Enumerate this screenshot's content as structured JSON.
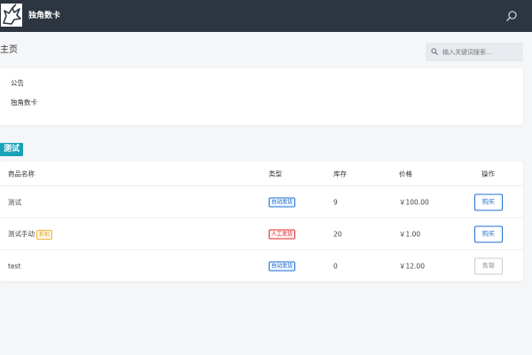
{
  "nav": {
    "brand": "独角数卡"
  },
  "header": {
    "page_title": "主页",
    "search_placeholder": "输入关键词搜索..."
  },
  "notice": {
    "title": "公告",
    "text": "独角数卡"
  },
  "category": {
    "name": "测试"
  },
  "table": {
    "columns": [
      "商品名称",
      "类型",
      "库存",
      "价格",
      "操作"
    ],
    "rows": [
      {
        "name": "测试",
        "badge": "",
        "type": "自动发货",
        "type_kind": "auto",
        "stock": "9",
        "price": "￥100.00",
        "action": "购买",
        "action_kind": "buy"
      },
      {
        "name": "测试手动",
        "badge": "折扣",
        "type": "人工发货",
        "type_kind": "manual",
        "stock": "20",
        "price": "￥1.00",
        "action": "购买",
        "action_kind": "buy"
      },
      {
        "name": "test",
        "badge": "",
        "type": "自动发货",
        "type_kind": "auto",
        "stock": "0",
        "price": "￥12.00",
        "action": "售罄",
        "action_kind": "sold"
      }
    ]
  },
  "colors": {
    "navbar": "#2d3541",
    "accent": "#17a2b8",
    "link": "#1f6fd1",
    "manual": "#e02d2d",
    "discount": "#e09a00"
  },
  "icons": {
    "logo": "unicorn-logo-icon",
    "search": "search-icon"
  }
}
